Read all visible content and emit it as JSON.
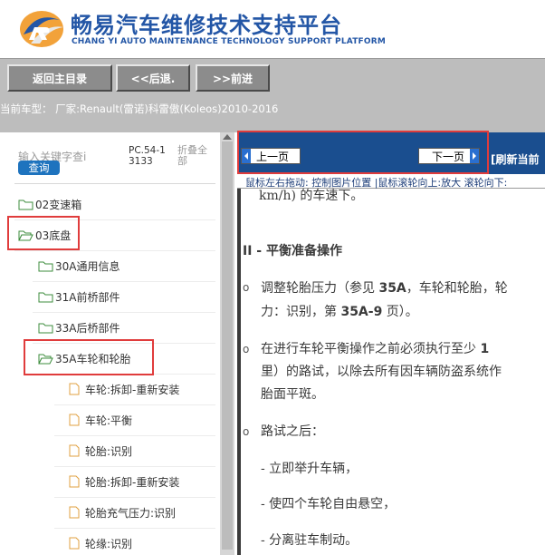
{
  "header": {
    "brand_cn": "畅易汽车维修技术支持平台",
    "brand_en": "CHANG YI AUTO MAINTENANCE TECHNOLOGY SUPPORT PLATFORM",
    "logo_icon": "car-logo-icon"
  },
  "nav": {
    "main_menu": "返回主目录",
    "back": "<<后退.",
    "forward": ">>前进"
  },
  "car_info": "当前车型： 厂家:Renault(雷诺)科雷傲(Koleos)2010-2016",
  "search": {
    "placeholder": "输入关键字查i",
    "query_label": "查询",
    "pc_code": "PC.54-13133",
    "collapse_all": "折叠全部"
  },
  "tree": {
    "items": [
      {
        "label": "02变速箱",
        "icon": "folder-icon"
      },
      {
        "label": "03底盘",
        "icon": "folder-open-icon"
      },
      {
        "label": "30A通用信息",
        "icon": "folder-icon"
      },
      {
        "label": "31A前桥部件",
        "icon": "folder-icon"
      },
      {
        "label": "33A后桥部件",
        "icon": "folder-icon"
      },
      {
        "label": "35A车轮和轮胎",
        "icon": "folder-open-icon"
      },
      {
        "label": "车轮:拆卸-重新安装",
        "icon": "doc-icon"
      },
      {
        "label": "车轮:平衡",
        "icon": "doc-icon"
      },
      {
        "label": "轮胎:识别",
        "icon": "doc-icon"
      },
      {
        "label": "轮胎:拆卸-重新安装",
        "icon": "doc-icon"
      },
      {
        "label": "轮胎充气压力:识别",
        "icon": "doc-icon"
      },
      {
        "label": "轮缘:识别",
        "icon": "doc-icon"
      }
    ]
  },
  "viewer": {
    "prev_page": "上一页",
    "next_page": "下一页",
    "refresh": "[刷新当前",
    "hint": "鼠标左右拖动: 控制图片位置 |鼠标滚轮向上:放大  滚轮向下:"
  },
  "doc": {
    "line0": "km/h) 的车速下。",
    "heading": "II - 平衡准备操作",
    "p1_a": "调整轮胎压力（参见",
    "p1_b": "35A",
    "p1_c": "，车轮和轮胎，轮",
    "p1_d": "力：识别，第",
    "p1_e": "35A-9",
    "p1_f": "页）。",
    "p2_a": "在进行车轮平衡操作之前必须执行至少",
    "p2_b": "1",
    "p2_c": "里）的路试，以除去所有因车辆防盗系统作",
    "p2_d": "胎面平斑。",
    "p3": "路试之后：",
    "s1": "- 立即举升车辆，",
    "s2": "- 使四个车轮自由悬空，",
    "s3": "- 分离驻车制动。",
    "bullet": "o"
  },
  "colors": {
    "brand": "#2356a6",
    "nav_bg": "#bdbdbd",
    "viewer_bar": "#1a4e8f",
    "highlight": "#e03c3c",
    "query": "#1e73be"
  }
}
